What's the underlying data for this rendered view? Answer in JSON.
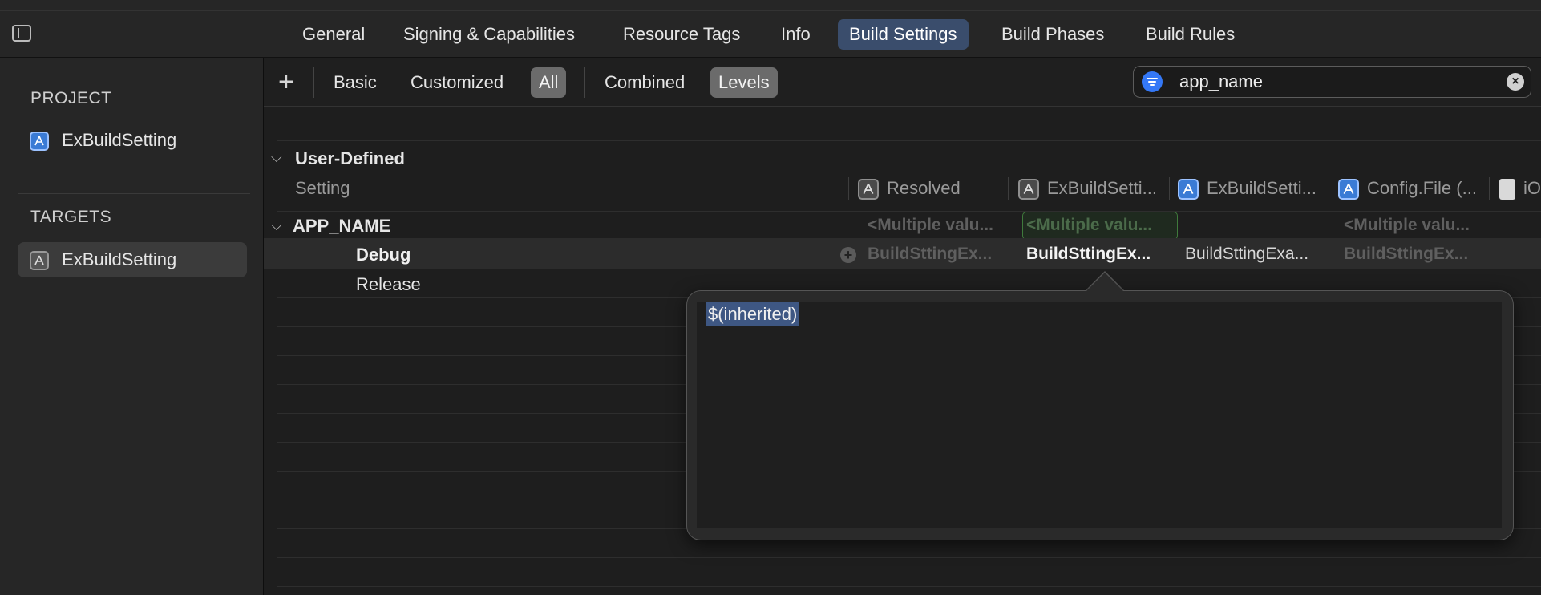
{
  "tabs": [
    {
      "label": "General",
      "active": false
    },
    {
      "label": "Signing & Capabilities",
      "active": false
    },
    {
      "label": "Resource Tags",
      "active": false
    },
    {
      "label": "Info",
      "active": false
    },
    {
      "label": "Build Settings",
      "active": true
    },
    {
      "label": "Build Phases",
      "active": false
    },
    {
      "label": "Build Rules",
      "active": false
    }
  ],
  "sidebar": {
    "project_title": "PROJECT",
    "project_item": "ExBuildSetting",
    "targets_title": "TARGETS",
    "target_item": "ExBuildSetting"
  },
  "filters": {
    "add": "+",
    "basic": "Basic",
    "customized": "Customized",
    "all": "All",
    "combined": "Combined",
    "levels": "Levels"
  },
  "search": {
    "value": "app_name"
  },
  "table": {
    "section": "User-Defined",
    "col_setting": "Setting",
    "col_resolved": "Resolved",
    "col_target": "ExBuildSetti...",
    "col_project": "ExBuildSetti...",
    "col_config": "Config.File (...",
    "col_ios": "iO",
    "setting_name": "APP_NAME",
    "row_multi_resolved": "<Multiple valu...",
    "row_multi_target": "<Multiple valu...",
    "row_multi_config": "<Multiple valu...",
    "debug_label": "Debug",
    "debug_resolved": "BuildSttingEx...",
    "debug_target": "BuildSttingEx...",
    "debug_project": "BuildSttingExa...",
    "debug_config": "BuildSttingEx...",
    "release_label": "Release"
  },
  "popover": {
    "text": "$(inherited)"
  },
  "colors": {
    "accent": "#3478f6",
    "selected_tab": "#3a4d6c",
    "green_border": "#3f7a3c"
  }
}
